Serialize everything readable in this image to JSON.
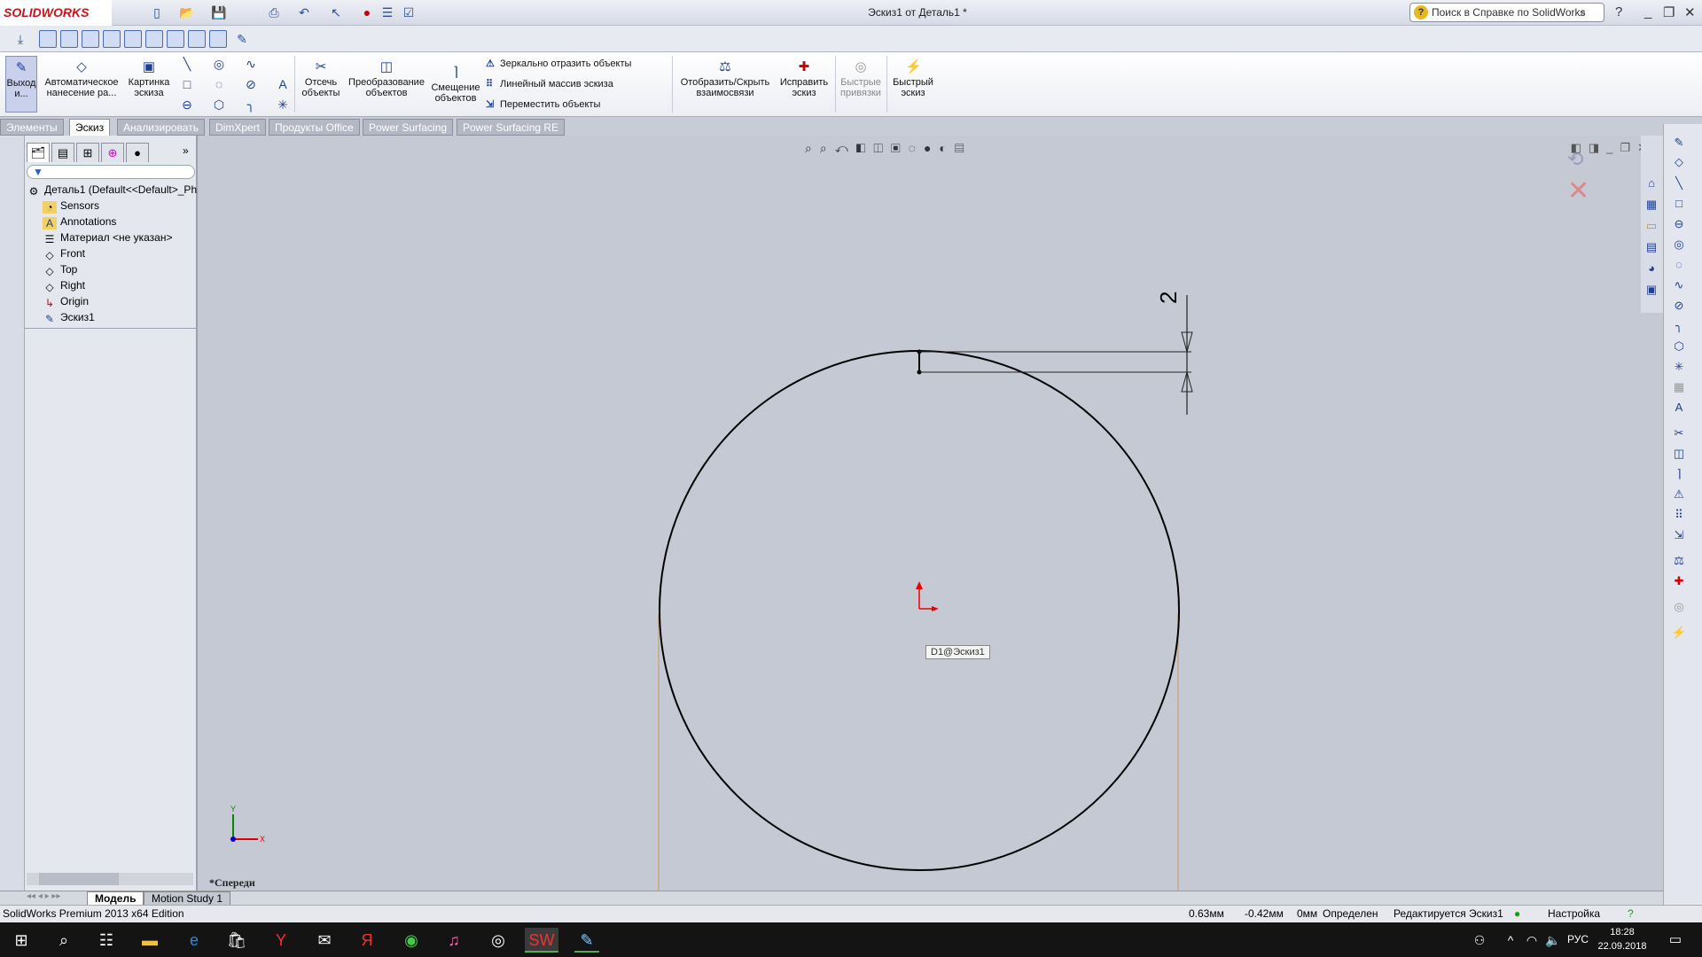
{
  "app": {
    "logo": "SOLIDWORKS",
    "title": "Эскиз1 от Деталь1 *",
    "help_search_placeholder": "Поиск в Справке по SolidWorks"
  },
  "ribbon": {
    "exit_sketch": "Выход и...",
    "auto_dimension": "Автоматическое нанесение ра...",
    "sketch_picture": "Картинка эскиза",
    "trim": "Отсечь объекты",
    "convert": "Преобразование объектов",
    "offset": "Смещение объектов",
    "mirror": "Зеркально отразить объекты",
    "linear_pattern": "Линейный массив эскиза",
    "move": "Переместить объекты",
    "relations": "Отобразить/Скрыть взаимосвязи",
    "repair": "Исправить эскиз",
    "quick_snaps": "Быстрые привязки",
    "rapid_sketch": "Быстрый эскиз"
  },
  "tabs": [
    "Элементы",
    "Эскиз",
    "Анализировать",
    "DimXpert",
    "Продукты Office",
    "Power Surfacing",
    "Power Surfacing RE"
  ],
  "active_tab": "Эскиз",
  "tree": {
    "root": "Деталь1  (Default<<Default>_Ph",
    "items": [
      "Sensors",
      "Annotations",
      "Материал <не указан>",
      "Front",
      "Top",
      "Right",
      "Origin",
      "Эскиз1"
    ]
  },
  "canvas": {
    "dimension_value": "2",
    "tooltip": "D1@Эскиз1",
    "view_name": "*Спереди",
    "triad_x": "X",
    "triad_y": "Y"
  },
  "bottom_tabs": [
    "Модель",
    "Motion Study 1"
  ],
  "status": {
    "edition": "SolidWorks Premium 2013 x64 Edition",
    "x": "0.63мм",
    "y": "-0.42мм",
    "z": "0мм",
    "state": "Определен",
    "editing": "Редактируется Эскиз1",
    "settings": "Настройка"
  },
  "taskbar": {
    "lang": "РУС",
    "time": "18:28",
    "date": "22.09.2018"
  },
  "colors": {
    "canvas": "#c5c9d4",
    "sketch": "#000000",
    "construction": "#c8a070",
    "origin": "#e00000"
  }
}
